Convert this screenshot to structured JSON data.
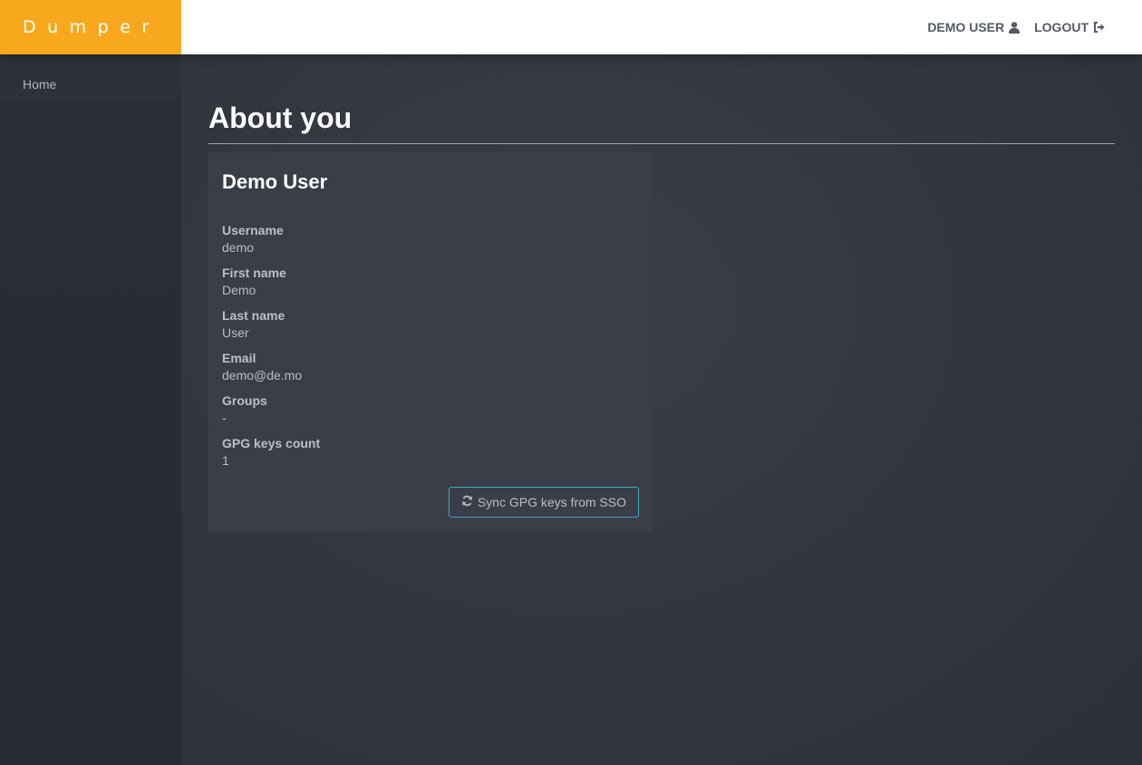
{
  "brand": {
    "name": "Dumper",
    "color": "#f8a81d"
  },
  "topnav": {
    "user_label": "DEMO USER",
    "user_icon": "user-icon",
    "logout_label": "LOGOUT",
    "logout_icon": "sign-out-icon"
  },
  "sidebar": {
    "items": [
      {
        "label": "Home"
      }
    ]
  },
  "main": {
    "page_title": "About you",
    "card": {
      "title": "Demo User",
      "fields": [
        {
          "label": "Username",
          "value": "demo"
        },
        {
          "label": "First name",
          "value": "Demo"
        },
        {
          "label": "Last name",
          "value": "User"
        },
        {
          "label": "Email",
          "value": "demo@de.mo"
        },
        {
          "label": "Groups",
          "value": "-"
        },
        {
          "label": "GPG keys count",
          "value": "1"
        }
      ],
      "sync_button": {
        "label": "Sync GPG keys from SSO",
        "icon": "refresh-icon",
        "border_color": "#3fa9c9"
      }
    }
  }
}
